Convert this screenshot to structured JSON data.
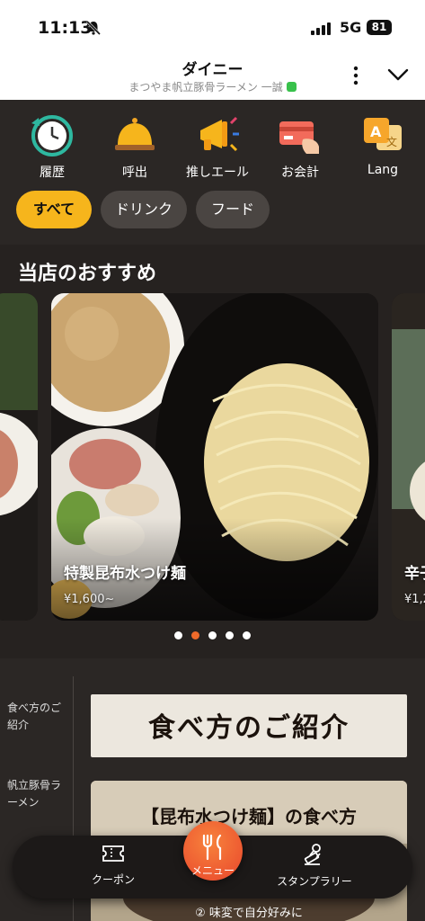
{
  "status_bar": {
    "time": "11:13",
    "network": "5G",
    "battery": "81"
  },
  "header": {
    "title": "ダイニー",
    "subtitle": "まつやま帆立豚骨ラーメン 一誠"
  },
  "shortcuts": [
    {
      "label": "履歴",
      "icon": "clock-history-icon"
    },
    {
      "label": "呼出",
      "icon": "service-bell-icon"
    },
    {
      "label": "推しエール",
      "icon": "megaphone-icon"
    },
    {
      "label": "お会計",
      "icon": "credit-card-icon"
    },
    {
      "label": "Lang",
      "icon": "translate-icon"
    }
  ],
  "categories": [
    {
      "label": "すべて",
      "active": true
    },
    {
      "label": "ドリンク",
      "active": false
    },
    {
      "label": "フード",
      "active": false
    }
  ],
  "recommended": {
    "title": "当店のおすすめ",
    "cards": [
      {
        "name": "特製昆布水つけ麺",
        "price": "¥1,600~"
      },
      {
        "name": "辛子",
        "price": "¥1,2"
      }
    ],
    "pager": {
      "count": 5,
      "active_index": 1
    }
  },
  "side_nav": [
    "食べ方のご紹介",
    "帆立豚骨ラーメン"
  ],
  "banners": {
    "how_to_eat": "食べ方のご紹介",
    "kombu_title": "【昆布水つけ麺】の食べ方",
    "kombu_step": "② 味変で自分好みに"
  },
  "bottom_nav": {
    "coupon": "クーポン",
    "menu": "メニュー",
    "stamp": "スタンプラリー"
  },
  "colors": {
    "accent": "#f6b51c",
    "menu_button": "#ef6a2a",
    "background": "#2b2725"
  }
}
